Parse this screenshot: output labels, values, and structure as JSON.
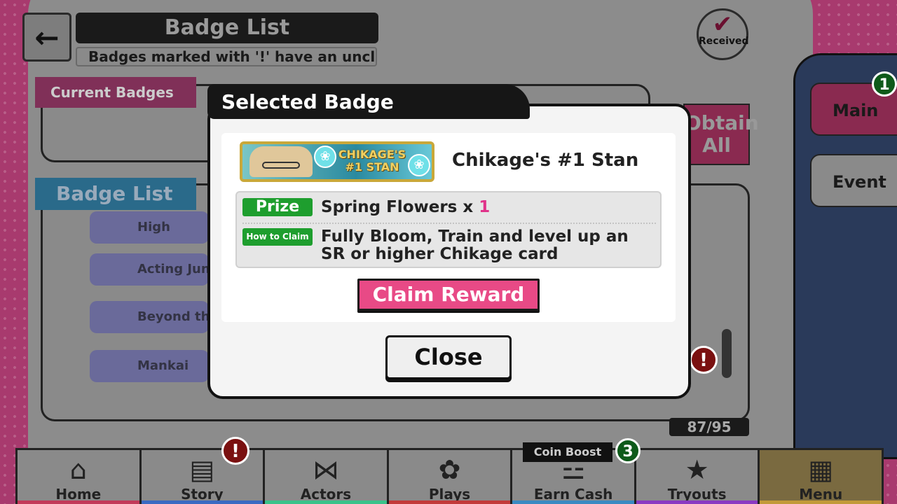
{
  "header": {
    "title": "Badge List",
    "subtitle": "Badges marked with '!' have an uncl",
    "received_label": "Received"
  },
  "sections": {
    "current_badges": "Current Badges",
    "badge_list": "Badge List",
    "obtain_all": "Obtain All"
  },
  "badge_rows": [
    "High",
    "Acting Junkie",
    "Beyond the",
    "Mankai"
  ],
  "list_count": "87/95",
  "side_tabs": {
    "main": "Main",
    "main_count": "1",
    "event": "Event"
  },
  "nav": {
    "items": [
      {
        "label": "Home",
        "icon": "home-icon",
        "color": "#c23a5a"
      },
      {
        "label": "Story",
        "icon": "book-icon",
        "color": "#3a6ac2"
      },
      {
        "label": "Actors",
        "icon": "bowtie-icon",
        "color": "#3ac28a"
      },
      {
        "label": "Plays",
        "icon": "stage-icon",
        "color": "#c23a3a"
      },
      {
        "label": "Earn Cash",
        "icon": "coins-icon",
        "color": "#3a8ac2"
      },
      {
        "label": "Tryouts",
        "icon": "star-card-icon",
        "color": "#8a3ac2"
      },
      {
        "label": "Menu",
        "icon": "grid-icon",
        "color": "#c29a3a"
      }
    ],
    "story_alert": "!",
    "coin_boost": "Coin Boost",
    "coin_boost_count": "3"
  },
  "modal": {
    "title": "Selected Badge",
    "badge_image_text": "CHIKAGE'S #1 STAN",
    "badge_name": "Chikage's #1 Stan",
    "prize_label": "Prize",
    "prize_item": "Spring Flowers x ",
    "prize_qty": "1",
    "how_label": "How to Claim",
    "how_text": "Fully Bloom, Train and level up an SR or higher Chikage card",
    "claim_button": "Claim Reward",
    "close_button": "Close"
  },
  "colors": {
    "accent_pink": "#e84a86",
    "prize_green": "#1e9e2e",
    "quantity_pink": "#e0338a"
  }
}
